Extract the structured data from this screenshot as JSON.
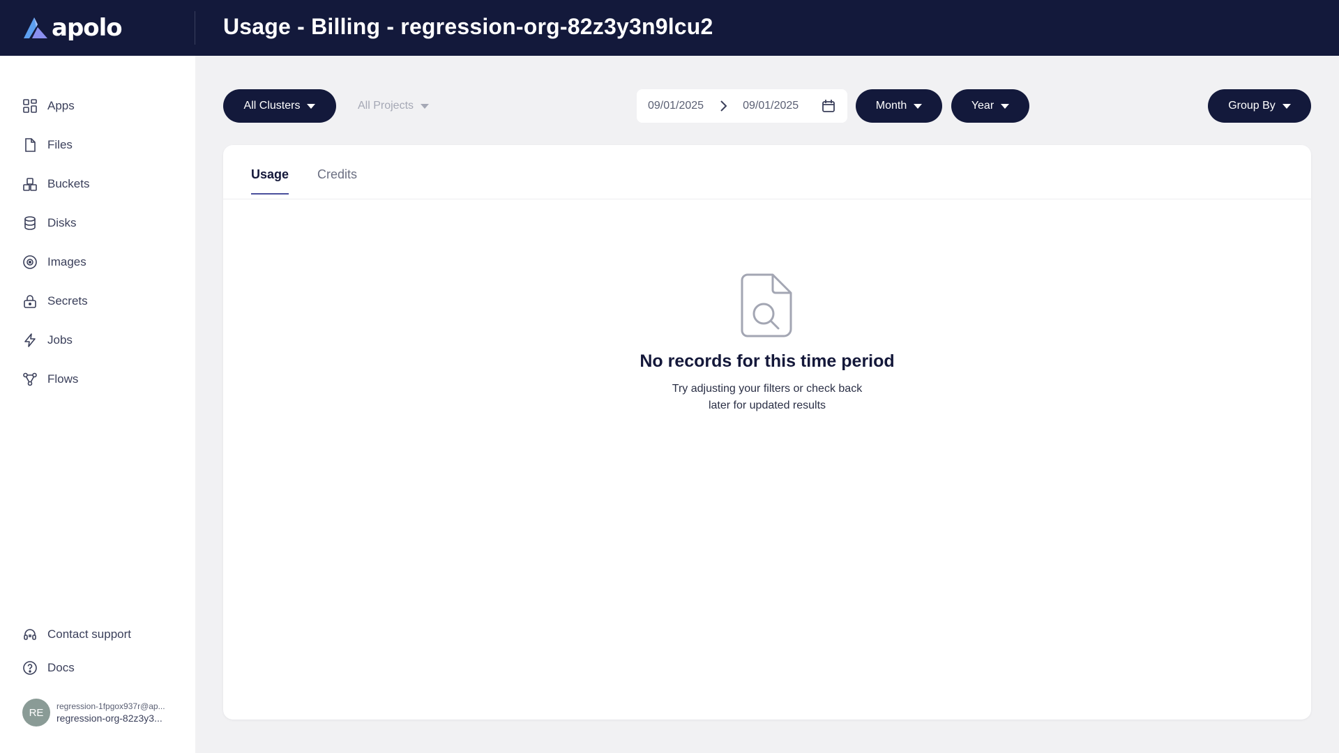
{
  "app": {
    "logo_text": "apolo",
    "page_title": "Usage - Billing - regression-org-82z3y3n9lcu2"
  },
  "sidebar": {
    "items": [
      {
        "label": "Apps",
        "icon": "grid-icon"
      },
      {
        "label": "Files",
        "icon": "file-icon"
      },
      {
        "label": "Buckets",
        "icon": "bucket-icon"
      },
      {
        "label": "Disks",
        "icon": "database-icon"
      },
      {
        "label": "Images",
        "icon": "image-icon"
      },
      {
        "label": "Secrets",
        "icon": "lock-icon"
      },
      {
        "label": "Jobs",
        "icon": "lightning-icon"
      },
      {
        "label": "Flows",
        "icon": "flow-icon"
      }
    ],
    "bottom_items": [
      {
        "label": "Contact support",
        "icon": "headset-icon"
      },
      {
        "label": "Docs",
        "icon": "help-circle-icon"
      }
    ],
    "user": {
      "initials": "RE",
      "email": "regression-1fpgox937r@ap...",
      "org": "regression-org-82z3y3..."
    }
  },
  "toolbar": {
    "clusters_label": "All Clusters",
    "projects_label": "All Projects",
    "date_start": "09/01/2025",
    "date_end": "09/01/2025",
    "period_label": "Month",
    "year_label": "Year",
    "group_by_label": "Group By"
  },
  "tabs": [
    {
      "label": "Usage",
      "active": true
    },
    {
      "label": "Credits",
      "active": false
    }
  ],
  "empty_state": {
    "title": "No records for this time period",
    "subtitle_line1": "Try adjusting your filters or check back",
    "subtitle_line2": "later for updated results"
  },
  "colors": {
    "header_bg": "#13193b",
    "accent": "#4a4f9c",
    "page_bg": "#f1f1f3",
    "avatar_bg": "#8a9b96"
  }
}
